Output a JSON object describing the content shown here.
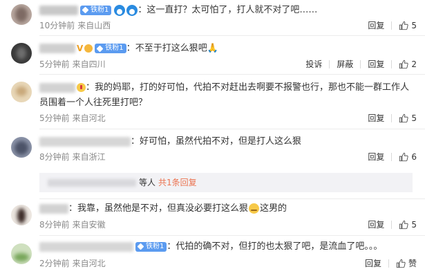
{
  "comments": [
    {
      "badge": "铁粉1",
      "colon": "：",
      "text": "这一直打？太可怕了，打人就不对了吧……",
      "time": "10分钟前",
      "location": "来自山西",
      "reply": "回复",
      "likes": "5"
    },
    {
      "vmark": "V",
      "badge": "铁粉1",
      "colon": "：",
      "text": "不至于打这么狠吧🙏",
      "time": "5分钟前",
      "location": "来自四川",
      "report": "投诉",
      "block": "屏蔽",
      "reply": "回复",
      "likes": "2"
    },
    {
      "colon": "：",
      "text": "我的妈耶，打的好可怕，代拍不对赶出去啊要不报警也行，那也不能一群工作人员围着一个人往死里打吧？",
      "time": "5分钟前",
      "location": "来自河北",
      "reply": "回复",
      "likes": "5"
    },
    {
      "colon": "：",
      "text": "好可怕，虽然代拍不对，但是打人这么狠",
      "time": "8分钟前",
      "location": "来自浙江",
      "reply": "回复",
      "likes": "6",
      "reply_summary": {
        "mid": "等人",
        "link": "共1条回复"
      }
    },
    {
      "colon": "：",
      "text_before": "我靠，虽然他是不对，但真没必要打这么狠",
      "text_after": "这男的",
      "time": "8分钟前",
      "location": "来自安徽",
      "reply": "回复",
      "likes": "5"
    },
    {
      "badge": "铁粉1",
      "colon": "：",
      "text": "代拍的确不对，但打的也太狠了吧，是流血了吧。。。",
      "time": "2分钟前",
      "location": "来自河北",
      "reply": "回复",
      "likes": "赞"
    }
  ],
  "colors": {
    "accent_link": "#eb7350",
    "badge_blue": "#5b9bf0",
    "meta_gray": "#8a8a8a"
  }
}
